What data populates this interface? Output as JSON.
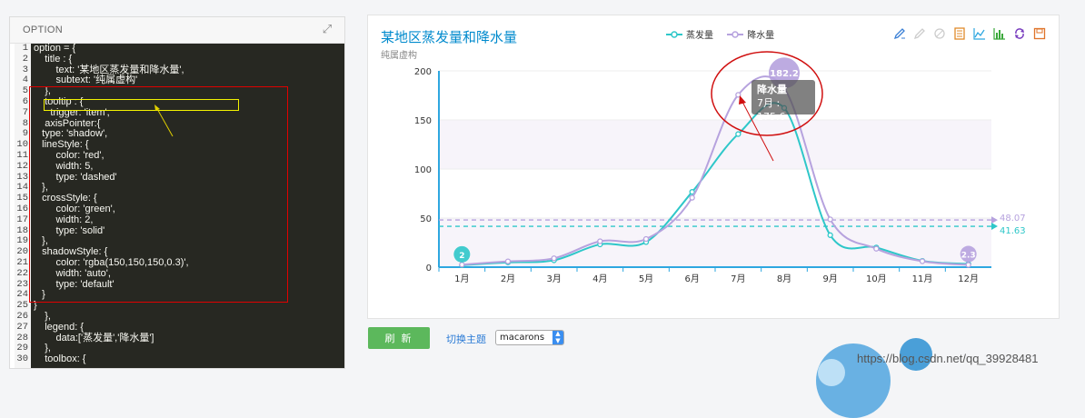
{
  "option_panel": {
    "title": "OPTION",
    "line_numbers": [
      "1",
      "2",
      "3",
      "4",
      "5",
      "6",
      "7",
      "8",
      "9",
      "10",
      "11",
      "12",
      "13",
      "14",
      "15",
      "16",
      "17",
      "18",
      "19",
      "20",
      "21",
      "22",
      "23",
      "24",
      "25",
      "26",
      "27",
      "28",
      "29",
      "30"
    ],
    "code_lines": [
      "option = {",
      "    title : {",
      "        text: '某地区蒸发量和降水量',",
      "        subtext: '纯属虚构'",
      "    },",
      "    tooltip : {",
      "      trigger: 'item',",
      "    axisPointer:{",
      "   type: 'shadow',",
      "   lineStyle: {",
      "        color: 'red',",
      "        width: 5,",
      "        type: 'dashed'",
      "   },",
      "   crossStyle: {",
      "        color: 'green',",
      "        width: 2,",
      "        type: 'solid'",
      "   },",
      "   shadowStyle: {",
      "        color: 'rgba(150,150,150,0.3)',",
      "        width: 'auto',",
      "        type: 'default'",
      "   }",
      "}",
      "    },",
      "    legend: {",
      "        data:['蒸发量','降水量']",
      "    },",
      "    toolbox: {"
    ]
  },
  "chart_panel": {
    "title": "某地区蒸发量和降水量",
    "subtitle": "纯属虚构",
    "legend": [
      {
        "label": "蒸发量",
        "color": "#2ec7c9"
      },
      {
        "label": "降水量",
        "color": "#b6a2de"
      }
    ],
    "toolbox_icons": [
      "mark-icon",
      "mark-undo-icon",
      "mark-clear-icon",
      "data-view-icon",
      "line-icon",
      "bar-icon",
      "restore-icon",
      "save-image-icon"
    ],
    "tooltip": {
      "series": "降水量",
      "text": "7月 : 175.6"
    }
  },
  "chart_data": {
    "type": "line",
    "categories": [
      "1月",
      "2月",
      "3月",
      "4月",
      "5月",
      "6月",
      "7月",
      "8月",
      "9月",
      "10月",
      "11月",
      "12月"
    ],
    "series": [
      {
        "name": "蒸发量",
        "color": "#2ec7c9",
        "values": [
          2.0,
          4.9,
          7.0,
          23.2,
          25.6,
          76.7,
          135.6,
          162.2,
          32.6,
          20.0,
          6.4,
          3.3
        ]
      },
      {
        "name": "降水量",
        "color": "#b6a2de",
        "values": [
          2.6,
          5.9,
          9.0,
          26.4,
          28.7,
          70.7,
          175.6,
          182.2,
          48.7,
          18.8,
          6.0,
          2.3
        ]
      }
    ],
    "ylim": [
      0,
      200
    ],
    "yticks": [
      0,
      50,
      100,
      150,
      200
    ],
    "mark_points": [
      {
        "series": "蒸发量",
        "label": "2",
        "month": "1月",
        "value": 2.0
      },
      {
        "series": "降水量",
        "label": "182.2",
        "month": "8月",
        "value": 182.2
      },
      {
        "series": "降水量",
        "label": "2.3",
        "month": "12月",
        "value": 2.3
      }
    ],
    "mark_lines": [
      {
        "series": "降水量",
        "label": "48.07",
        "value": 48.07
      },
      {
        "series": "蒸发量",
        "label": "41.63",
        "value": 41.63
      }
    ]
  },
  "controls": {
    "refresh_label": "刷 新",
    "theme_label": "切换主题",
    "theme_value": "macarons"
  },
  "watermark": "https://blog.csdn.net/qq_39928481"
}
